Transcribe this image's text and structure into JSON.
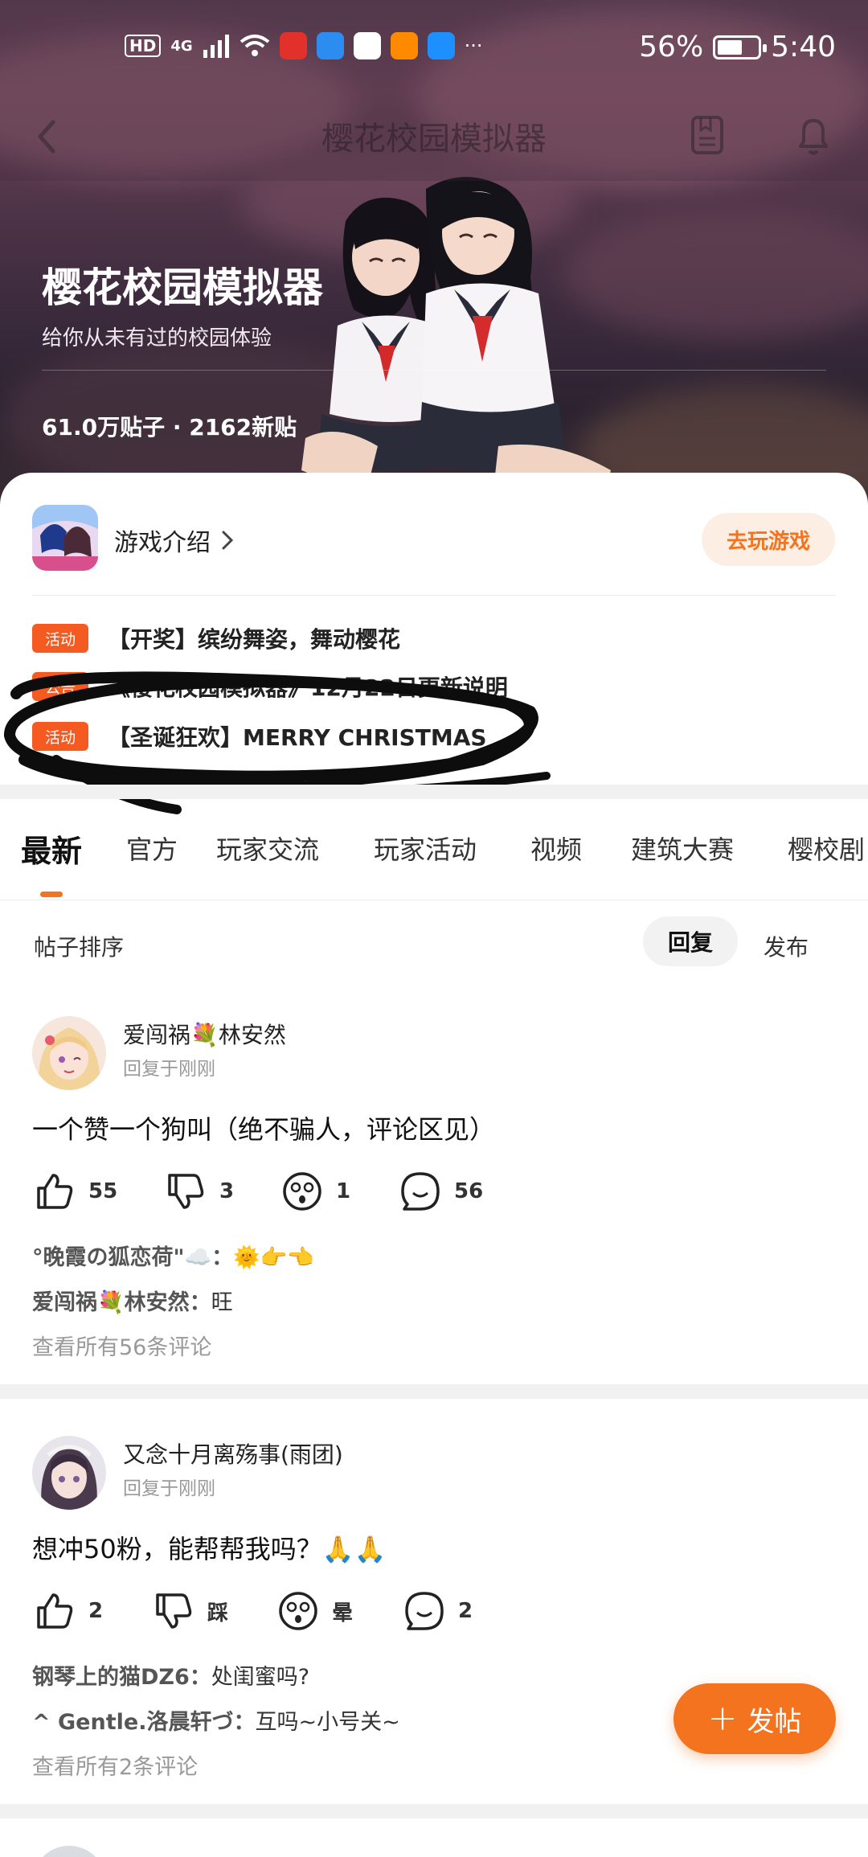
{
  "status_bar": {
    "left_labels": [
      "HD",
      "4G"
    ],
    "battery_percent": "56%",
    "battery_level": 0.56,
    "time": "5:40",
    "more": "···"
  },
  "nav": {
    "title": "樱花校园模拟器"
  },
  "forum": {
    "title": "樱花校园模拟器",
    "subtitle": "给你从未有过的校园体验",
    "stats": "61.0万贴子 · 2162新贴"
  },
  "game_card": {
    "intro_label": "游戏介绍",
    "play_button": "去玩游戏",
    "notices": [
      {
        "tag": "活动",
        "text": "【开奖】缤纷舞姿，舞动樱花"
      },
      {
        "tag": "公告",
        "text": "《樱花校园模拟器》12月22日更新说明"
      },
      {
        "tag": "活动",
        "text": "【圣诞狂欢】MERRY CHRISTMAS"
      }
    ]
  },
  "tabs": [
    "最新",
    "官方",
    "玩家交流",
    "玩家活动",
    "视频",
    "建筑大赛",
    "樱校剧"
  ],
  "sort": {
    "label": "帖子排序",
    "options": [
      "回复",
      "发布"
    ],
    "selected": "回复"
  },
  "posts": [
    {
      "user": "爱闯祸💐林安然",
      "time": "回复于刚刚",
      "text": "一个赞一个狗叫（绝不骗人，评论区见）",
      "likes": "55",
      "dislikes": "3",
      "dizzy": "1",
      "comments": "56",
      "top_comments": [
        {
          "who": "°晚霞の狐恋荷\"☁️：",
          "text": "🌞👉👈"
        },
        {
          "who": "爱闯祸💐林安然：",
          "text": "旺"
        }
      ],
      "view_all": "查看所有56条评论"
    },
    {
      "user": "又念十月离殇事(雨团)",
      "time": "回复于刚刚",
      "text": "想冲50粉，能帮帮我吗？🙏🙏",
      "likes": "2",
      "dislikes": "踩",
      "dizzy": "晕",
      "comments": "2",
      "top_comments": [
        {
          "who": "钢琴上的猫DZ6：",
          "text": "处闺蜜吗?"
        },
        {
          "who": "^ Gentle.洛晨轩づ：",
          "text": "互吗~小号关~"
        }
      ],
      "view_all": "查看所有2条评论"
    }
  ],
  "fab": {
    "label": "发帖"
  },
  "colors": {
    "accent": "#f4731f",
    "tag": "#f55a20",
    "play_bg": "#fdeee4"
  }
}
